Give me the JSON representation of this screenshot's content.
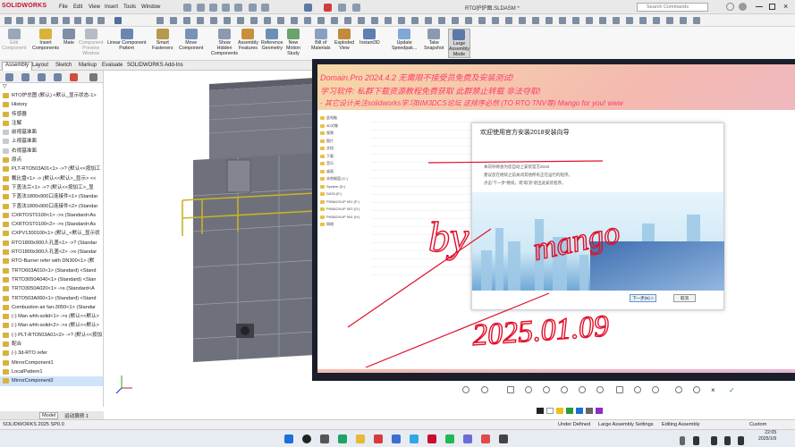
{
  "app": {
    "brand": "SOLIDWORKS",
    "doc_title": "RTO护炉图.SLDASM *",
    "search_placeholder": "Search Commands"
  },
  "menu": [
    "File",
    "Edit",
    "View",
    "Insert",
    "Tools",
    "Window"
  ],
  "ribbon": [
    {
      "label": "Edit\nComponent",
      "disabled": true
    },
    {
      "label": "Insert\nComponents"
    },
    {
      "label": "Mate"
    },
    {
      "label": "Component\nPreview\nWindow",
      "disabled": true
    },
    {
      "label": "Linear Component\nPattern"
    },
    {
      "label": "Smart\nFasteners"
    },
    {
      "label": "Move\nComponent"
    },
    {
      "label": "Show\nHidden\nComponents"
    },
    {
      "label": "Assembly\nFeatures"
    },
    {
      "label": "Reference\nGeometry"
    },
    {
      "label": "New\nMotion\nStudy"
    },
    {
      "label": "Bill of\nMaterials"
    },
    {
      "label": "Exploded\nView"
    },
    {
      "label": "Instant3D"
    },
    {
      "label": "Update\nSpeedpak..."
    },
    {
      "label": "Take\nSnapshot"
    },
    {
      "label": "Large\nAssembly\nMode",
      "active": true
    }
  ],
  "command_tabs": [
    "Assembly",
    "Layout",
    "Sketch",
    "Markup",
    "Evaluate",
    "SOLIDWORKS Add-Ins"
  ],
  "tree": [
    "RTO炉总图 (默认) <默认_显示状态-1>",
    "History",
    "传感器",
    "注解",
    "前视基准面",
    "上视基准面",
    "右视基准面",
    "原点",
    "PLT-RTO503A01<1> ->? (默认<<按加工",
    "戴比盘<1> -> (默认<<默认>_显示> <<",
    "下盖法兰<1> ->? (默认<<按加工>_显",
    "下盖法1800x900口连接件<1> (Standar",
    "下盖法1800x900口连接件<2> (Standar",
    "CXRTOST0100<1> ->x (Standard<As",
    "CXRTOST0100<2> ->x (Standard<As",
    "CXPV1300100<1> (默认_<默认_显示状",
    "RTO1800x900人孔盖<1> ->? (Standar",
    "RTO1800x900人孔盖<2> ->x (Standar",
    "RTO-Burner refer with DN300<1> (默",
    "TRTO603A010<1> (Standard) <Stand",
    "TRTO3050A040<1> (Standard) <Stan",
    "TRTO3050A020<1> ->x (Standard<A",
    "TRTO503A060<1> (Standard) <Stand",
    "Combustion air fan-3050<1> (Standar",
    "(-) Man whh-solid<1> ->x (默认<<默认>",
    "(-) Man whh-solid<2> ->x (默认<<默认>",
    "(-) PLT-RTO503A01<2> ->? (默认<<按加",
    "配合",
    "(-) 3d-RTO refer",
    "MirrorComponent1",
    "LocalPattern1",
    "MirrorComponent2"
  ],
  "bottom_tabs": [
    "Model",
    "运动算例 1"
  ],
  "status": {
    "version": "SOLIDWORKS 2025 SP0.0",
    "state": "Under Defined",
    "mode": "Large Assembly Settings",
    "editing": "Editing Assembly",
    "units": "Custom"
  },
  "overlay": {
    "watermark": [
      "Domain.Pro 2024.4.2 无需限不接受员免费及安装测试!",
      "学习软件: 私群下载资源教程免费获取 此群禁止转载 非法夺取!",
      "- 其它设计关注solidworks学习BIM3DCS论坛 这排序必然 (TO RTO TNV等) Mango for you! www"
    ],
    "setup_title": "欢迎使用官方安装2018安装向导",
    "setup_lines": [
      "本向导将会为您自动上安装官方2018",
      "建议您在继续之前关闭其他所有正在运行的程序。",
      "点击“下一步”继续，或“取消”退出此安装程序。"
    ],
    "next_button": "下一步(N) >",
    "cancel_button": "取消",
    "explorer": [
      "此电脑",
      "3D对象",
      "视频",
      "图片",
      "文档",
      "下载",
      "音乐",
      "桌面",
      "本地磁盘 (C:)",
      "System (D:)",
      "DATA (E:)",
      "PKBACKUP 001 (F:)",
      "PKBACKUP 003 (G:)",
      "PKBACKUP 004 (H:)",
      "网络"
    ],
    "handwriting": [
      "by",
      "mango",
      "2025.01.09"
    ]
  },
  "clock": {
    "time": "22:05",
    "date": "2025/1/9"
  },
  "colors": {
    "accent": "#c8102e",
    "tree_icon": "#d9b23a",
    "handwriting": "#e0102a"
  }
}
